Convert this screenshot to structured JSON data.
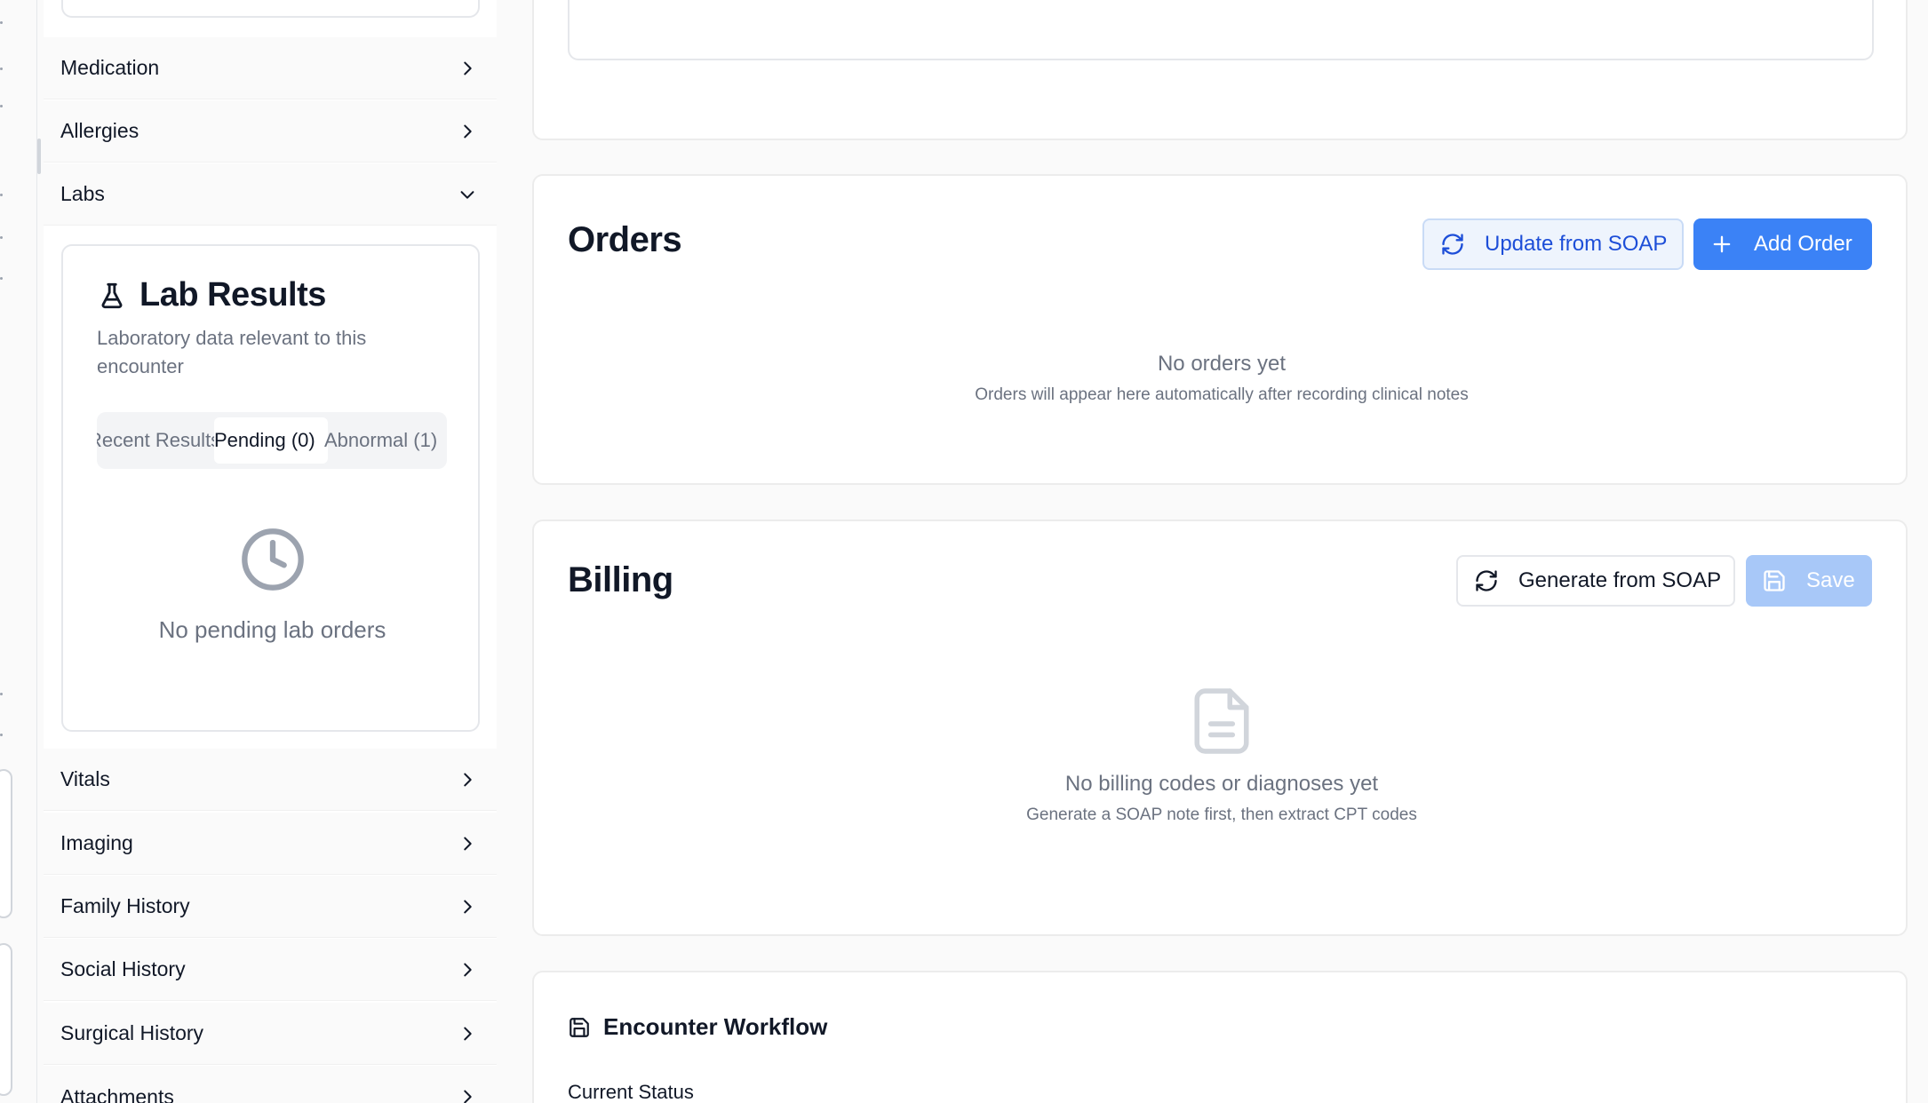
{
  "sidebar": {
    "items_top": [
      {
        "label": "Medication",
        "state": "collapsed"
      },
      {
        "label": "Allergies",
        "state": "collapsed"
      },
      {
        "label": "Labs",
        "state": "expanded"
      }
    ],
    "items_bottom": [
      {
        "label": "Vitals"
      },
      {
        "label": "Imaging"
      },
      {
        "label": "Family History"
      },
      {
        "label": "Social History"
      },
      {
        "label": "Surgical History"
      },
      {
        "label": "Attachments"
      }
    ],
    "lab_results": {
      "icon": "flask-icon",
      "title": "Lab Results",
      "subtitle": "Laboratory data relevant to this encounter",
      "tabs": [
        {
          "label": "Recent Results",
          "active": false
        },
        {
          "label": "Pending (0)",
          "active": true
        },
        {
          "label": "Abnormal (1)",
          "active": false
        }
      ],
      "empty_icon": "clock-icon",
      "empty_text": "No pending lab orders"
    }
  },
  "orders": {
    "title": "Orders",
    "update_button": "Update from SOAP",
    "add_button": "Add Order",
    "empty_title": "No orders yet",
    "empty_subtitle": "Orders will appear here automatically after recording clinical notes"
  },
  "billing": {
    "title": "Billing",
    "generate_button": "Generate from SOAP",
    "save_button": "Save",
    "save_disabled": true,
    "empty_title": "No billing codes or diagnoses yet",
    "empty_subtitle": "Generate a SOAP note first, then extract CPT codes"
  },
  "workflow": {
    "title": "Encounter Workflow",
    "status_label": "Current Status"
  },
  "colors": {
    "primary": "#3b82f6",
    "primary_text": "#1d4ed8",
    "muted_text": "#6b7280",
    "border": "#e5e7eb"
  }
}
